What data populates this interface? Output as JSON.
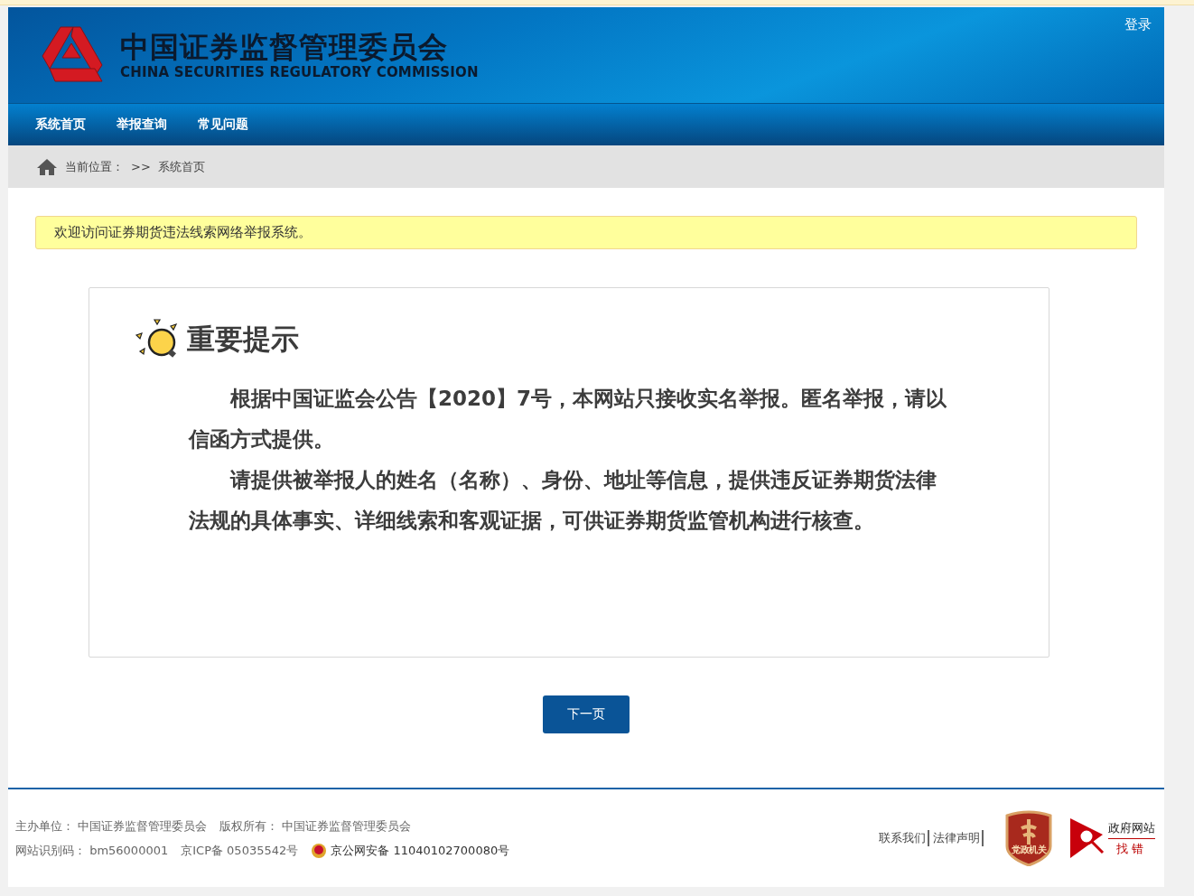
{
  "header": {
    "title_cn": "中国证券监督管理委员会",
    "title_en": "CHINA SECURITIES REGULATORY COMMISSION",
    "login": "登录"
  },
  "nav": [
    {
      "label": "系统首页"
    },
    {
      "label": "举报查询"
    },
    {
      "label": "常见问题"
    }
  ],
  "breadcrumb": {
    "label": "当前位置：",
    "separator": ">>",
    "current": "系统首页"
  },
  "notice": "欢迎访问证券期货违法线索网络举报系统。",
  "card": {
    "title": "重要提示",
    "paragraphs": [
      "根据中国证监会公告【2020】7号，本网站只接收实名举报。匿名举报，请以信函方式提供。",
      "请提供被举报人的姓名（名称）、身份、地址等信息，提供违反证券期货法律法规的具体事实、详细线索和客观证据，可供证券期货监管机构进行核查。"
    ]
  },
  "next_button": "下一页",
  "footer": {
    "sponsor": "主办单位： 中国证券监督管理委员会",
    "copyright": "版权所有： 中国证券监督管理委员会",
    "site_code": "网站识别码： bm56000001",
    "icp": "京ICP备 05035542号",
    "police": "京公网安备 11040102700080号",
    "links": [
      "联系我们",
      "法律声明"
    ],
    "party_badge": "党政机关",
    "gov_finder": {
      "top": "政府网站",
      "bottom": "找错"
    }
  }
}
